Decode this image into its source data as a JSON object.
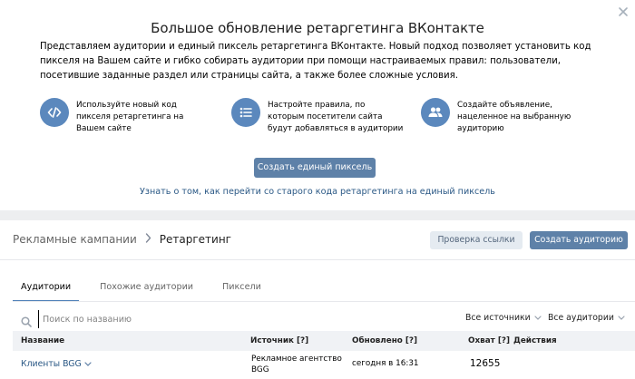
{
  "promo": {
    "title": "Большое обновление ретаргетинга ВКонтакте",
    "description": "Представляем аудитории и единый пиксель ретаргетинга ВКонтакте. Новый подход позволяет установить код пикселя на Вашем сайте и гибко собирать аудитории при помощи настраиваемых правил: пользователи, посетившие заданные раздел или страницы сайта, а также более сложные условия.",
    "features": [
      {
        "icon": "code-icon",
        "text": "Используйте новый код пикселя ретаргетинга на Вашем сайте"
      },
      {
        "icon": "list-icon",
        "text": "Настройте правила, по которым посетители сайта будут добавляться в аудитории"
      },
      {
        "icon": "users-icon",
        "text": "Создайте объявление, нацеленное на выбранную аудиторию"
      }
    ],
    "primary_button": "Создать единый пиксель",
    "migrate_link": "Узнать о том, как перейти со старого кода ретаргетинга на единый пиксель"
  },
  "header": {
    "breadcrumb_parent": "Рекламные кампании",
    "breadcrumb_current": "Ретаргетинг",
    "check_link_button": "Проверка ссылки",
    "create_audience_button": "Создать аудиторию"
  },
  "tabs": [
    {
      "label": "Аудитории",
      "active": true
    },
    {
      "label": "Похожие аудитории",
      "active": false
    },
    {
      "label": "Пиксели",
      "active": false
    }
  ],
  "search": {
    "placeholder": "Поиск по названию",
    "value": ""
  },
  "filters": {
    "sources": "Все источники",
    "audiences": "Все аудитории"
  },
  "table": {
    "columns": {
      "name": "Название",
      "source": "Источник [?]",
      "updated": "Обновлено [?]",
      "reach": "Охват [?]",
      "actions": "Действия"
    },
    "rows": [
      {
        "name": "Клиенты BGG",
        "source": "Рекламное агентство BGG",
        "updated": "сегодня в 16:31",
        "reach": "12655"
      }
    ]
  },
  "colors": {
    "accent": "#5e81a8",
    "icon_circle": "#5b88bd",
    "link": "#2a5885",
    "background": "#edeef0"
  }
}
